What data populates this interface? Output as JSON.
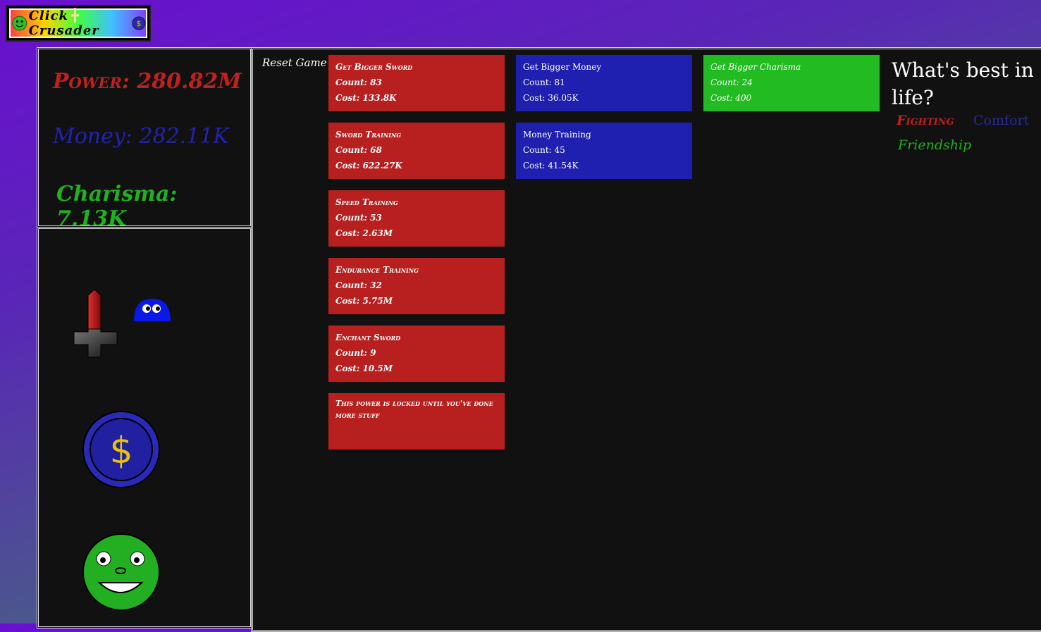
{
  "app": {
    "title": "Click Crusader",
    "logo_left": "Click",
    "logo_right": "Crusader"
  },
  "stats": {
    "power": "Power: 280.82M",
    "money": "Money: 282.11K",
    "charisma": "Charisma: 7.13K"
  },
  "controls": {
    "reset_label": "Reset Game"
  },
  "power_upgrades": [
    {
      "title": "Get Bigger Sword",
      "count": "Count: 83",
      "cost": "Cost: 133.8K"
    },
    {
      "title": "Sword Training",
      "count": "Count: 68",
      "cost": "Cost: 622.27K"
    },
    {
      "title": "Speed Training",
      "count": "Count: 53",
      "cost": "Cost: 2.63M"
    },
    {
      "title": "Endurance Training",
      "count": "Count: 32",
      "cost": "Cost: 5.75M"
    },
    {
      "title": "Enchant Sword",
      "count": "Count: 9",
      "cost": "Cost: 10.5M"
    },
    {
      "locked": "This power is locked until you've done more stuff"
    }
  ],
  "money_upgrades": [
    {
      "title": "Get Bigger Money",
      "count": "Count: 81",
      "cost": "Cost: 36.05K"
    },
    {
      "title": "Money Training",
      "count": "Count: 45",
      "cost": "Cost: 41.54K"
    }
  ],
  "charisma_upgrades": [
    {
      "title": "Get Bigger Charisma",
      "count": "Count: 24",
      "cost": "Cost: 400"
    }
  ],
  "sidebar": {
    "question": "What's best in life?",
    "options": [
      "Fighting",
      "Comfort",
      "Friendship"
    ]
  },
  "colors": {
    "power": "#c02020",
    "money": "#2020b0",
    "charisma": "#20b020",
    "panel": "#111111"
  },
  "icons": {
    "logo_left": "smiley-icon",
    "logo_sep": "sword-icon",
    "logo_right": "coin-icon",
    "clickers": [
      "sword-icon",
      "blob-icon",
      "coin-icon",
      "smiley-face-icon"
    ]
  }
}
